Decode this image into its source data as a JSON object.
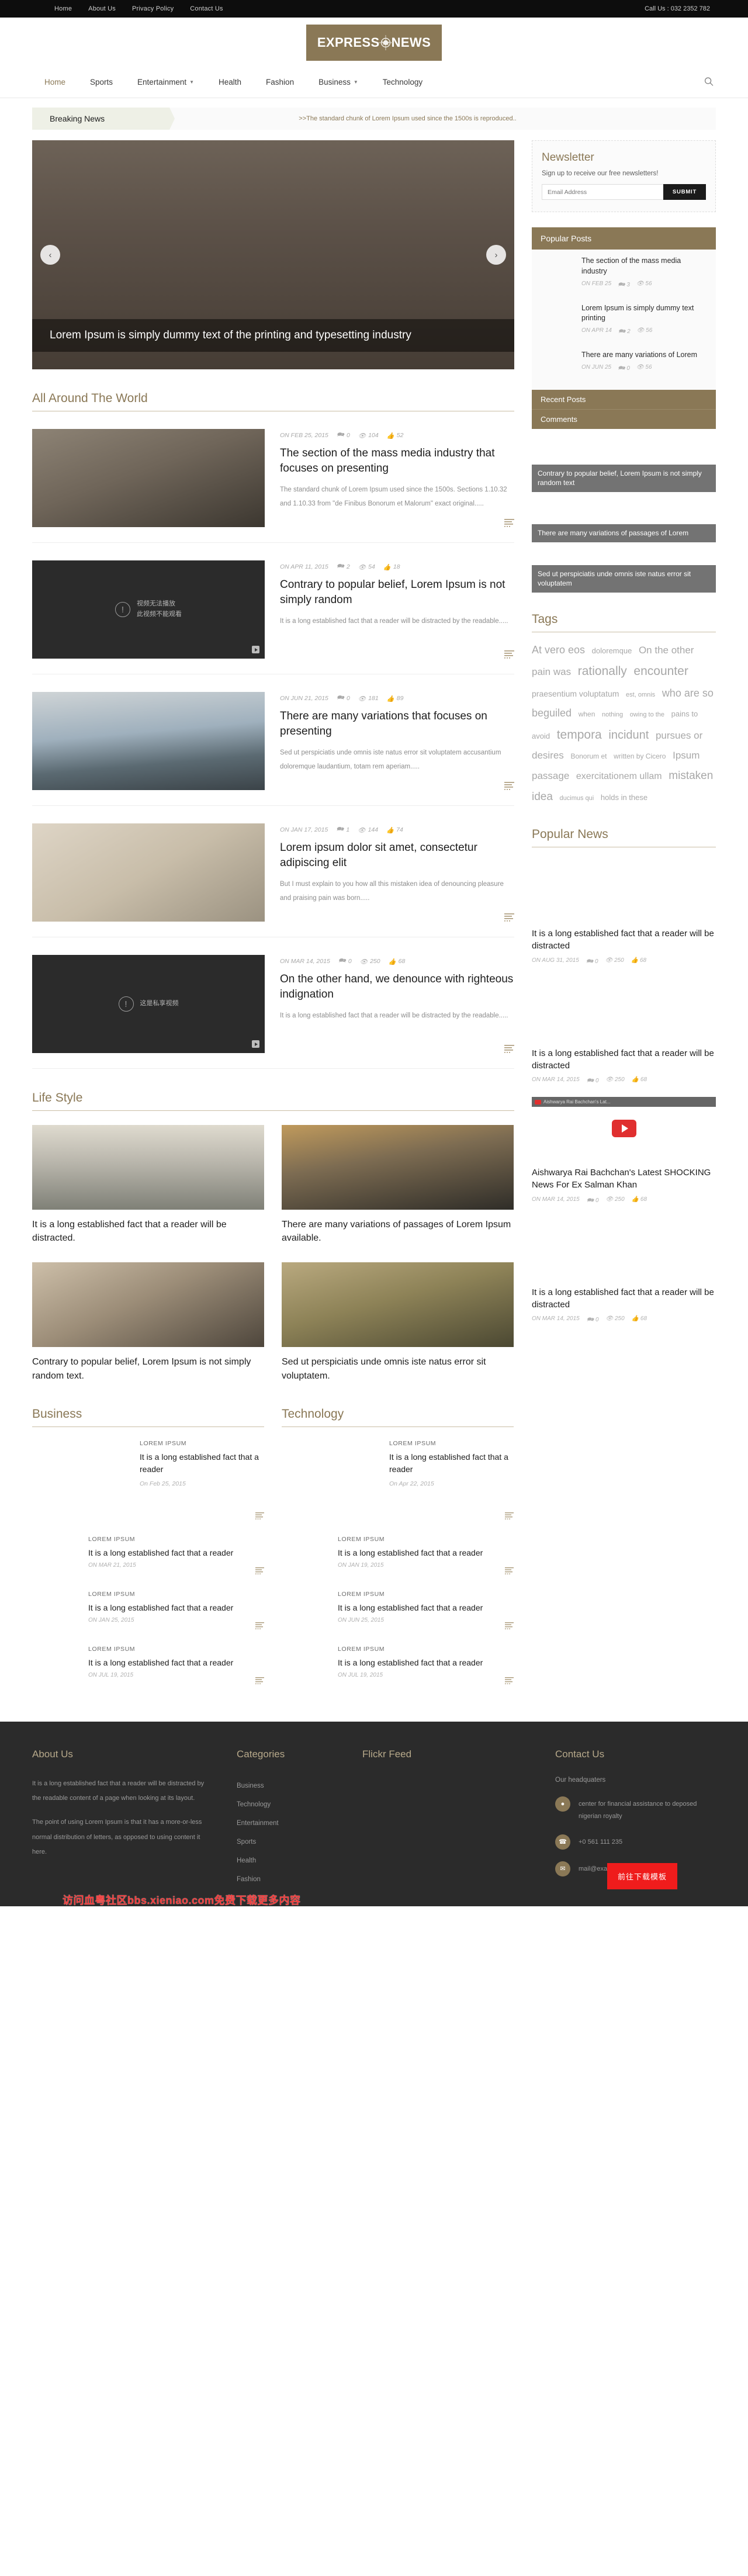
{
  "topbar": {
    "links": [
      "Home",
      "About Us",
      "Privacy Policy",
      "Contact Us"
    ],
    "call": "Call Us : 032 2352 782"
  },
  "brand": {
    "part1": "EXPRESS",
    "part2": "NEWS",
    "accent": "#8a7856"
  },
  "mainnav": {
    "items": [
      {
        "label": "Home",
        "caret": false
      },
      {
        "label": "Sports",
        "caret": false
      },
      {
        "label": "Entertainment",
        "caret": true
      },
      {
        "label": "Health",
        "caret": false
      },
      {
        "label": "Fashion",
        "caret": false
      },
      {
        "label": "Business",
        "caret": true
      },
      {
        "label": "Technology",
        "caret": false
      }
    ],
    "search_icon": "search-icon"
  },
  "breaking": {
    "label": "Breaking News",
    "text": ">>The standard chunk of Lorem Ipsum used since the 1500s is reproduced.."
  },
  "slider": {
    "caption": "Lorem Ipsum is simply dummy text of the printing and typesetting industry",
    "prev": "‹",
    "next": "›"
  },
  "sections": {
    "world": "All Around The World",
    "lifestyle": "Life Style",
    "business": "Business",
    "technology": "Technology"
  },
  "articles": [
    {
      "date": "ON FEB 25, 2015",
      "comments": "0",
      "views": "104",
      "likes": "52",
      "title": "The section of the mass media industry that focuses on presenting",
      "excerpt": "The standard chunk of Lorem Ipsum used since the 1500s. Sections 1.10.32 and 1.10.33 from \"de Finibus Bonorum et Malorum\" exact original.....",
      "media": "photo",
      "img": "im-news1"
    },
    {
      "date": "ON APR 11, 2015",
      "comments": "2",
      "views": "54",
      "likes": "18",
      "title": "Contrary to popular belief, Lorem Ipsum is not simply random",
      "excerpt": "It is a long established fact that a reader will be distracted by the readable.....",
      "media": "video",
      "video_line1": "视频无法播放",
      "video_line2": "此视频不能观看"
    },
    {
      "date": "ON JUN 21, 2015",
      "comments": "0",
      "views": "181",
      "likes": "89",
      "title": "There are many variations that focuses on presenting",
      "excerpt": "Sed ut perspiciatis unde omnis iste natus error sit voluptatem accusantium doloremque laudantium, totam rem aperiam.....",
      "media": "photo",
      "img": "im-lake"
    },
    {
      "date": "ON JAN 17, 2015",
      "comments": "1",
      "views": "144",
      "likes": "74",
      "title": "Lorem ipsum dolor sit amet, consectetur adipiscing elit",
      "excerpt": "But I must explain to you how all this mistaken idea of denouncing pleasure and praising pain was born.....",
      "media": "photo",
      "img": "im-paper"
    },
    {
      "date": "ON MAR 14, 2015",
      "comments": "0",
      "views": "250",
      "likes": "68",
      "title": "On the other hand, we denounce with righteous indignation",
      "excerpt": "It is a long established fact that a reader will be distracted by the readable.....",
      "media": "video",
      "video_line1": "这是私享视频",
      "video_line2": ""
    }
  ],
  "lifestyle": [
    {
      "title": "It is a long established fact that a reader will be distracted.",
      "img": "im-sail"
    },
    {
      "title": "There are many variations of passages of Lorem Ipsum available.",
      "img": "im-surf"
    },
    {
      "title": "Contrary to popular belief, Lorem Ipsum is not simply random text.",
      "img": "im-yoga"
    },
    {
      "title": "Sed ut perspiciatis unde omnis iste natus error sit voluptatem.",
      "img": "im-field"
    }
  ],
  "business": {
    "first": {
      "kicker": "LOREM IPSUM",
      "title": "It is a long established fact that a reader",
      "date": "On Feb 25, 2015",
      "img": "im-laptop"
    },
    "rows": [
      {
        "kicker": "LOREM IPSUM",
        "title": "It is a long established fact that a reader",
        "date": "ON MAR 21, 2015",
        "img": "im-pen"
      },
      {
        "kicker": "LOREM IPSUM",
        "title": "It is a long established fact that a reader",
        "date": "ON JAN 25, 2015",
        "img": "im-key"
      },
      {
        "kicker": "LOREM IPSUM",
        "title": "It is a long established fact that a reader",
        "date": "ON JUL 19, 2015",
        "img": "im-man"
      }
    ]
  },
  "technology": {
    "first": {
      "kicker": "LOREM IPSUM",
      "title": "It is a long established fact that a reader",
      "date": "On Apr 22, 2015",
      "img": "im-tablet"
    },
    "rows": [
      {
        "kicker": "LOREM IPSUM",
        "title": "It is a long established fact that a reader",
        "date": "ON JAN 19, 2015",
        "img": "im-phone"
      },
      {
        "kicker": "LOREM IPSUM",
        "title": "It is a long established fact that a reader",
        "date": "ON JUN 25, 2015",
        "img": "im-google"
      },
      {
        "kicker": "LOREM IPSUM",
        "title": "It is a long established fact that a reader",
        "date": "ON JUL 19, 2015",
        "img": "im-ipad"
      }
    ]
  },
  "sidebar": {
    "newsletter": {
      "title": "Newsletter",
      "desc": "Sign up to receive our free newsletters!",
      "placeholder": "Email Address",
      "button": "SUBMIT"
    },
    "popular_posts": {
      "title": "Popular Posts",
      "items": [
        {
          "title": "The section of the mass media industry",
          "date": "ON FEB 25",
          "comments": "3",
          "views": "56",
          "img": "im-pen"
        },
        {
          "title": "Lorem Ipsum is simply dummy text printing",
          "date": "ON APR 14",
          "comments": "2",
          "views": "56",
          "img": "im-laptop"
        },
        {
          "title": "There are many variations of Lorem",
          "date": "ON JUN 25",
          "comments": "0",
          "views": "56",
          "img": "im-key"
        }
      ],
      "tabs": [
        "Recent Posts",
        "Comments"
      ]
    },
    "stack": [
      {
        "caption": "Contrary to popular belief, Lorem Ipsum is not simply random text",
        "img": "im-snow"
      },
      {
        "caption": "There are many variations of passages of Lorem",
        "img": "im-tram"
      },
      {
        "caption": "Sed ut perspiciatis unde omnis iste natus error sit voluptatem",
        "img": "im-fire"
      }
    ],
    "tags": {
      "title": "Tags",
      "items": [
        {
          "label": "At vero eos",
          "size": 18
        },
        {
          "label": "doloremque",
          "size": 13
        },
        {
          "label": "On the other",
          "size": 17
        },
        {
          "label": "pain was",
          "size": 17
        },
        {
          "label": "rationally",
          "size": 21
        },
        {
          "label": "encounter",
          "size": 21
        },
        {
          "label": "praesentium voluptatum",
          "size": 14
        },
        {
          "label": "est, omnis",
          "size": 11
        },
        {
          "label": "who are so beguiled",
          "size": 18
        },
        {
          "label": "when",
          "size": 12
        },
        {
          "label": "nothing",
          "size": 11
        },
        {
          "label": "owing to the",
          "size": 11
        },
        {
          "label": "pains to avoid",
          "size": 13
        },
        {
          "label": "tempora",
          "size": 21
        },
        {
          "label": "incidunt",
          "size": 20
        },
        {
          "label": "pursues or desires",
          "size": 17
        },
        {
          "label": "Bonorum et",
          "size": 12
        },
        {
          "label": "written by Cicero",
          "size": 12
        },
        {
          "label": "Ipsum passage",
          "size": 17
        },
        {
          "label": "exercitationem ullam",
          "size": 16
        },
        {
          "label": "mistaken idea",
          "size": 19
        },
        {
          "label": "ducimus qui",
          "size": 11
        },
        {
          "label": "holds in these",
          "size": 13
        }
      ]
    },
    "popular_news": {
      "title": "Popular News",
      "items": [
        {
          "title": "It is a long established fact that a reader will be distracted",
          "date": "ON AUG 31, 2015",
          "comments": "0",
          "views": "250",
          "likes": "68",
          "img": "im-car",
          "type": "photo"
        },
        {
          "title": "It is a long established fact that a reader will be distracted",
          "date": "ON MAR 14, 2015",
          "comments": "0",
          "views": "250",
          "likes": "68",
          "img": "im-desk",
          "type": "photo"
        },
        {
          "title": "Aishwarya Rai Bachchan's Latest SHOCKING News For Ex Salman Khan",
          "date": "ON MAR 14, 2015",
          "comments": "0",
          "views": "250",
          "likes": "68",
          "img": "im-model",
          "type": "video",
          "video_bar": "Aishwarya Rai Bachchan's Lat..."
        },
        {
          "title": "It is a long established fact that a reader will be distracted",
          "date": "ON MAR 14, 2015",
          "comments": "0",
          "views": "250",
          "likes": "68",
          "img": "im-anchor",
          "type": "photo"
        }
      ]
    }
  },
  "footer": {
    "about": {
      "title": "About Us",
      "p1": "It is a long established fact that a reader will be distracted by the readable content of a page when looking at its layout.",
      "p2": "The point of using Lorem Ipsum is that it has a more-or-less normal distribution of letters, as opposed to using content it here."
    },
    "categories": {
      "title": "Categories",
      "items": [
        "Business",
        "Technology",
        "Entertainment",
        "Sports",
        "Health",
        "Fashion"
      ]
    },
    "flickr": {
      "title": "Flickr Feed",
      "thumbs": [
        "im-man",
        "im-pen",
        "im-key",
        "im-tablet",
        "im-phone",
        "im-google",
        "im-pen",
        "im-key"
      ]
    },
    "contact": {
      "title": "Contact Us",
      "sub": "Our headquaters",
      "address": "center for financial assistance to deposed nigerian royalty",
      "phone": "+0 561 111 235",
      "email": "mail@example.com"
    },
    "download_badge": "前往下载模板",
    "watermark": "访问血粤社区bbs.xieniao.com免费下载更多内容"
  },
  "icons": {
    "comment": "💬",
    "view": "◉",
    "like": "☝",
    "readmore": "readmore-icon"
  }
}
